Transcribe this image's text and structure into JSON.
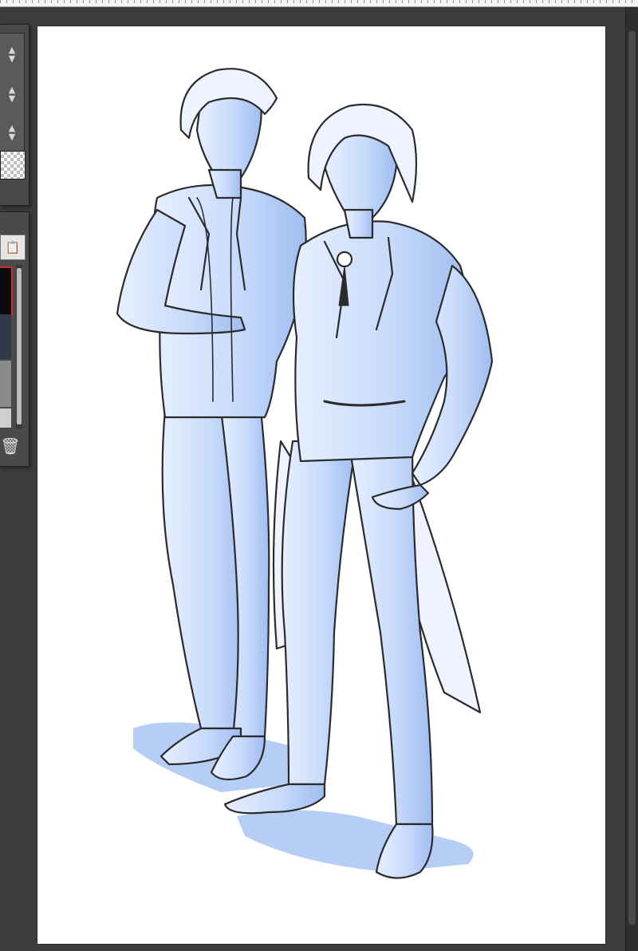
{
  "app": {
    "colors": {
      "workspace": "#3c3c3c",
      "paper": "#ffffff",
      "figure_fill": "#c9dcfb",
      "shadow": "#a9c6f2",
      "lineart": "#2b2b2b",
      "selected_layer_border": "#d42a2a"
    }
  },
  "left_panel": {
    "steppers": [
      {
        "up_icon": "▲",
        "down_icon": "▼"
      },
      {
        "up_icon": "▲",
        "down_icon": "▼"
      },
      {
        "up_icon": "▲",
        "down_icon": "▼"
      }
    ],
    "transparency_swatch": "checkerboard-icon"
  },
  "layer_panel": {
    "layer_property_icon": "📋",
    "trash_icon": "🗑",
    "selected_layer_index": 0
  },
  "canvas": {
    "subject": "two-figure-sketch"
  }
}
